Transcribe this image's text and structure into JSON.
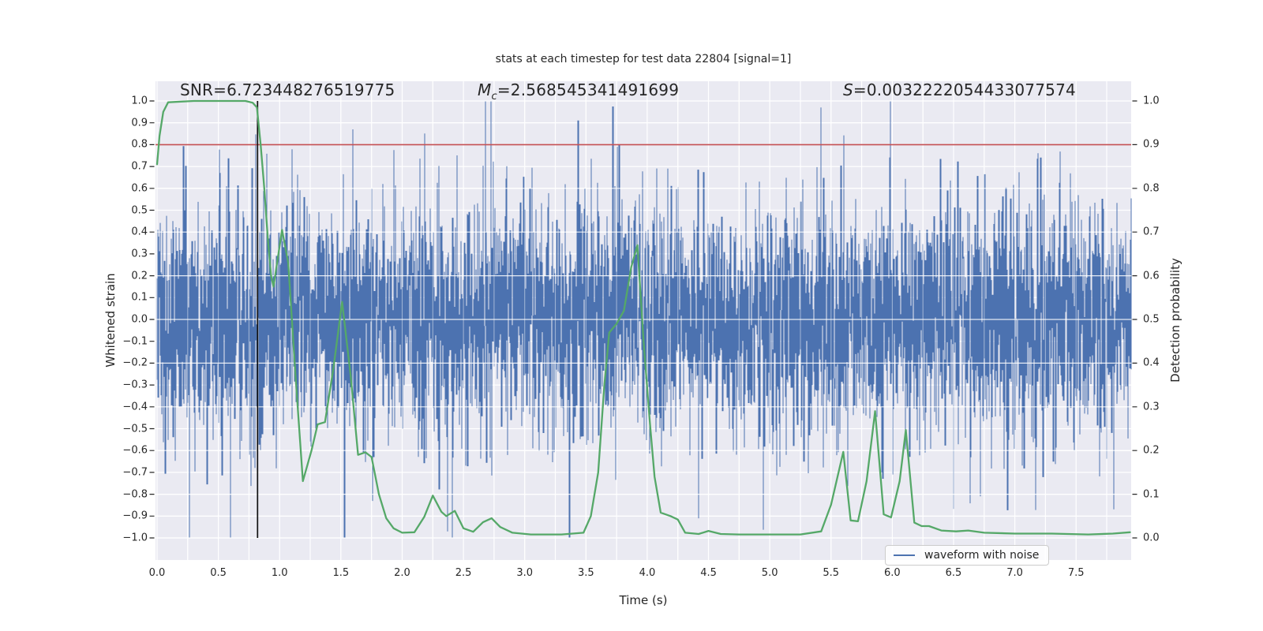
{
  "title": "stats at each timestep for test data 22804 [signal=1]",
  "annotations": {
    "snr": {
      "prefix": "SNR",
      "value": "=6.723448276519775",
      "italic": false
    },
    "mc": {
      "prefix": "M",
      "sub": "c",
      "value": "=2.568545341491699",
      "italic": true
    },
    "s": {
      "prefix": "S",
      "value": "=0.0032222054433077574",
      "italic": true
    }
  },
  "axes": {
    "xlabel": "Time (s)",
    "ylabel_left": "Whitened strain",
    "ylabel_right": "Detection probability"
  },
  "legend": {
    "label": "waveform with noise",
    "position": "lower right"
  },
  "colors": {
    "waveform": "#4c72b0",
    "probability": "#55a868",
    "threshold": "#c44e52",
    "event_marker": "#111111",
    "axes_background": "#eaeaf2",
    "grid": "#ffffff",
    "text": "#262626"
  },
  "chart_data": {
    "type": "line",
    "title": "stats at each timestep for test data 22804 [signal=1]",
    "xlabel": "Time (s)",
    "ylabel": "Whitened strain",
    "ylabel2": "Detection probability",
    "xlim": [
      0,
      7.95
    ],
    "ylim_left": [
      -1.09,
      1.09
    ],
    "ylim_right": [
      -0.045,
      1.045
    ],
    "x_ticks": [
      0.0,
      0.5,
      1.0,
      1.5,
      2.0,
      2.5,
      3.0,
      3.5,
      4.0,
      4.5,
      5.0,
      5.5,
      6.0,
      6.5,
      7.0,
      7.5
    ],
    "x_grid_step": 0.25,
    "left_ticks": [
      -1.0,
      -0.9,
      -0.8,
      -0.7,
      -0.6,
      -0.5,
      -0.4,
      -0.3,
      -0.2,
      -0.1,
      0.0,
      0.1,
      0.2,
      0.3,
      0.4,
      0.5,
      0.6,
      0.7,
      0.8,
      0.9,
      1.0
    ],
    "right_ticks": [
      0.0,
      0.1,
      0.2,
      0.3,
      0.4,
      0.5,
      0.6,
      0.7,
      0.8,
      0.9,
      1.0
    ],
    "grid": true,
    "legend_position": "lower right",
    "threshold_line": {
      "axis": "right",
      "value": 0.9
    },
    "event_marker": {
      "time": 0.82,
      "span_left_axis": [
        -1.0,
        1.0
      ]
    },
    "series": [
      {
        "name": "waveform with noise",
        "axis": "left",
        "style": "dense-noise",
        "description": "whitened strain noise, zero-mean gaussian band ~±0.35 with spikes to ~±0.97",
        "sigma": 0.26,
        "spike_sigma": 0.45,
        "spike_fraction": 0.05,
        "samples_per_pixel": 4,
        "seed": 22804,
        "notable_extremes": [
          [
            1.6,
            0.87
          ],
          [
            2.37,
            -0.97
          ],
          [
            4.42,
            -0.91
          ],
          [
            5.42,
            0.97
          ]
        ]
      },
      {
        "name": "detection probability",
        "axis": "right",
        "style": "line",
        "points": [
          [
            0.0,
            0.855
          ],
          [
            0.02,
            0.92
          ],
          [
            0.05,
            0.975
          ],
          [
            0.09,
            0.997
          ],
          [
            0.3,
            1.0
          ],
          [
            0.6,
            1.0
          ],
          [
            0.72,
            1.0
          ],
          [
            0.78,
            0.996
          ],
          [
            0.815,
            0.985
          ],
          [
            0.845,
            0.9
          ],
          [
            0.875,
            0.8
          ],
          [
            0.905,
            0.68
          ],
          [
            0.93,
            0.6
          ],
          [
            0.95,
            0.575
          ],
          [
            1.02,
            0.705
          ],
          [
            1.07,
            0.63
          ],
          [
            1.13,
            0.37
          ],
          [
            1.19,
            0.13
          ],
          [
            1.26,
            0.2
          ],
          [
            1.31,
            0.26
          ],
          [
            1.37,
            0.265
          ],
          [
            1.44,
            0.39
          ],
          [
            1.51,
            0.54
          ],
          [
            1.58,
            0.37
          ],
          [
            1.64,
            0.19
          ],
          [
            1.7,
            0.196
          ],
          [
            1.75,
            0.185
          ],
          [
            1.81,
            0.1
          ],
          [
            1.87,
            0.045
          ],
          [
            1.93,
            0.022
          ],
          [
            2.0,
            0.012
          ],
          [
            2.1,
            0.013
          ],
          [
            2.18,
            0.048
          ],
          [
            2.25,
            0.097
          ],
          [
            2.32,
            0.06
          ],
          [
            2.36,
            0.05
          ],
          [
            2.43,
            0.062
          ],
          [
            2.5,
            0.022
          ],
          [
            2.58,
            0.014
          ],
          [
            2.66,
            0.036
          ],
          [
            2.73,
            0.045
          ],
          [
            2.8,
            0.025
          ],
          [
            2.9,
            0.012
          ],
          [
            3.05,
            0.008
          ],
          [
            3.3,
            0.008
          ],
          [
            3.48,
            0.012
          ],
          [
            3.54,
            0.05
          ],
          [
            3.6,
            0.15
          ],
          [
            3.65,
            0.35
          ],
          [
            3.69,
            0.47
          ],
          [
            3.75,
            0.49
          ],
          [
            3.81,
            0.52
          ],
          [
            3.87,
            0.62
          ],
          [
            3.92,
            0.67
          ],
          [
            3.97,
            0.45
          ],
          [
            4.02,
            0.27
          ],
          [
            4.06,
            0.14
          ],
          [
            4.11,
            0.058
          ],
          [
            4.19,
            0.05
          ],
          [
            4.25,
            0.042
          ],
          [
            4.31,
            0.012
          ],
          [
            4.42,
            0.009
          ],
          [
            4.5,
            0.016
          ],
          [
            4.6,
            0.009
          ],
          [
            4.75,
            0.008
          ],
          [
            5.0,
            0.008
          ],
          [
            5.25,
            0.008
          ],
          [
            5.42,
            0.015
          ],
          [
            5.5,
            0.076
          ],
          [
            5.6,
            0.197
          ],
          [
            5.66,
            0.04
          ],
          [
            5.72,
            0.038
          ],
          [
            5.79,
            0.13
          ],
          [
            5.86,
            0.29
          ],
          [
            5.93,
            0.054
          ],
          [
            5.99,
            0.047
          ],
          [
            6.06,
            0.13
          ],
          [
            6.11,
            0.247
          ],
          [
            6.18,
            0.035
          ],
          [
            6.24,
            0.027
          ],
          [
            6.3,
            0.027
          ],
          [
            6.4,
            0.017
          ],
          [
            6.52,
            0.015
          ],
          [
            6.62,
            0.017
          ],
          [
            6.75,
            0.012
          ],
          [
            7.0,
            0.01
          ],
          [
            7.3,
            0.01
          ],
          [
            7.6,
            0.008
          ],
          [
            7.8,
            0.01
          ],
          [
            7.94,
            0.013
          ]
        ]
      }
    ]
  }
}
